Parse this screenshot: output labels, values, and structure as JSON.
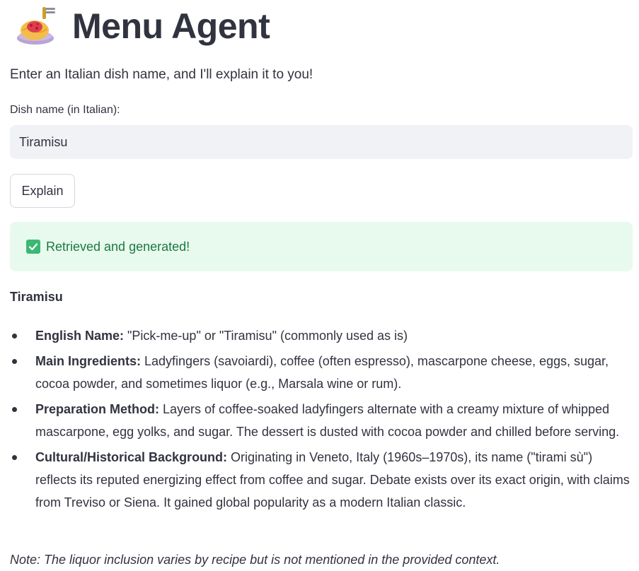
{
  "header": {
    "icon": "spaghetti-plate-icon",
    "title": "Menu Agent",
    "subtitle": "Enter an Italian dish name, and I'll explain it to you!"
  },
  "form": {
    "label": "Dish name (in Italian):",
    "value": "Tiramisu",
    "button_label": "Explain"
  },
  "status": {
    "icon": "check-mark-icon",
    "text": "Retrieved and generated!",
    "colors": {
      "background": "#e8f9ee",
      "text": "#1b7a40",
      "icon": "#3cb872"
    }
  },
  "result": {
    "heading": "Tiramisu",
    "items": [
      {
        "label": "English Name:",
        "text": " \"Pick-me-up\" or \"Tiramisu\" (commonly used as is)"
      },
      {
        "label": "Main Ingredients:",
        "text": " Ladyfingers (savoiardi), coffee (often espresso), mascarpone cheese, eggs, sugar, cocoa powder, and sometimes liquor (e.g., Marsala wine or rum)."
      },
      {
        "label": "Preparation Method:",
        "text": " Layers of coffee-soaked ladyfingers alternate with a creamy mixture of whipped mascarpone, egg yolks, and sugar. The dessert is dusted with cocoa powder and chilled before serving."
      },
      {
        "label": "Cultural/Historical Background:",
        "text": " Originating in Veneto, Italy (1960s–1970s), its name (\"tirami sù\") reflects its reputed energizing effect from coffee and sugar. Debate exists over its exact origin, with claims from Treviso or Siena. It gained global popularity as a modern Italian classic."
      }
    ],
    "note": "Note: The liquor inclusion varies by recipe but is not mentioned in the provided context."
  }
}
